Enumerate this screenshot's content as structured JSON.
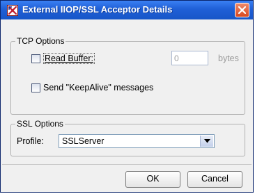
{
  "window": {
    "title": "External IIOP/SSL Acceptor Details",
    "app_icon": "app-x-icon",
    "close_icon": "close-icon",
    "title_bar_color": "#1f5fd6",
    "close_color": "#d8481f"
  },
  "tcp_options": {
    "legend": "TCP Options",
    "read_buffer": {
      "label": "Read Buffer:",
      "checked": false,
      "value": "0",
      "unit": "bytes",
      "enabled": false
    },
    "keepalive": {
      "label": "Send \"KeepAlive\" messages",
      "checked": false
    }
  },
  "ssl_options": {
    "legend": "SSL Options",
    "profile_label": "Profile:",
    "profile_value": "SSLServer",
    "dropdown_icon": "chevron-down-icon"
  },
  "buttons": {
    "ok": "OK",
    "cancel": "Cancel"
  }
}
